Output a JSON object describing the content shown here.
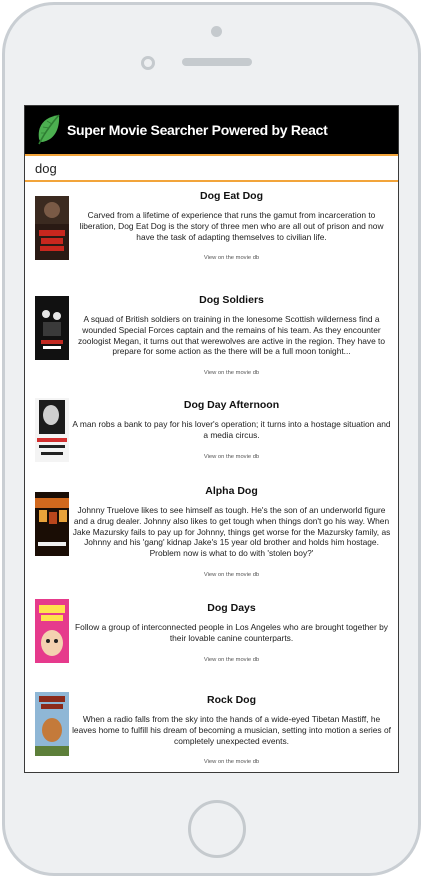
{
  "app": {
    "title": "Super Movie Searcher Powered by React",
    "brand_color": "#000000",
    "accent_color": "#f2a43a",
    "logo_icon": "leaf-icon",
    "logo_color": "#4caf50"
  },
  "search": {
    "value": "dog"
  },
  "movies": [
    {
      "title": "Dog Eat Dog",
      "description": "Carved from a lifetime of experience that runs the gamut from incarceration to liberation, Dog Eat Dog is the story of three men who are all out of prison and now have the task of adapting themselves to civilian life.",
      "link": "View on the movie db"
    },
    {
      "title": "Dog Soldiers",
      "description": "A squad of British soldiers on training in the lonesome Scottish wilderness find a wounded Special Forces captain and the remains of his team. As they encounter zoologist Megan, it turns out that werewolves are active in the region. They have to prepare for some action as the there will be a full moon tonight...",
      "link": "View on the movie db"
    },
    {
      "title": "Dog Day Afternoon",
      "description": "A man robs a bank to pay for his lover's operation; it turns into a hostage situation and a media circus.",
      "link": "View on the movie db"
    },
    {
      "title": "Alpha Dog",
      "description": "Johnny Truelove likes to see himself as tough. He's the son of an underworld figure and a drug dealer. Johnny also likes to get tough when things don't go his way. When Jake Mazursky fails to pay up for Johnny, things get worse for the Mazursky family, as Johnny and his 'gang' kidnap Jake's 15 year old brother and holds him hostage. Problem now is what to do with 'stolen boy?'",
      "link": "View on the movie db"
    },
    {
      "title": "Dog Days",
      "description": "Follow a group of interconnected people in Los Angeles who are brought together by their lovable canine counterparts.",
      "link": "View on the movie db"
    },
    {
      "title": "Rock Dog",
      "description": "When a radio falls from the sky into the hands of a wide-eyed Tibetan Mastiff, he leaves home to fulfill his dream of becoming a musician, setting into motion a series of completely unexpected events.",
      "link": "View on the movie db"
    }
  ]
}
